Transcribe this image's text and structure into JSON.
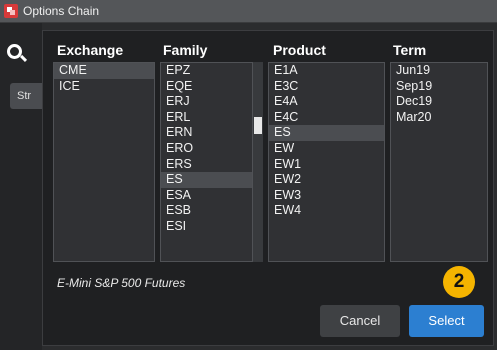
{
  "window": {
    "title": "Options Chain"
  },
  "sidebar": {
    "tab_label": "Str"
  },
  "headers": {
    "exchange": "Exchange",
    "family": "Family",
    "product": "Product",
    "term": "Term"
  },
  "exchange": {
    "items": [
      "CME",
      "ICE"
    ],
    "selected": 0
  },
  "family": {
    "items": [
      "EPZ",
      "EQE",
      "ERJ",
      "ERL",
      "ERN",
      "ERO",
      "ERS",
      "ES",
      "ESA",
      "ESB",
      "ESI"
    ],
    "selected": 7
  },
  "product": {
    "items": [
      "E1A",
      "E3C",
      "E4A",
      "E4C",
      "ES",
      "EW",
      "EW1",
      "EW2",
      "EW3",
      "EW4"
    ],
    "selected": 4
  },
  "term": {
    "items": [
      "Jun19",
      "Sep19",
      "Dec19",
      "Mar20"
    ],
    "selected": -1
  },
  "description": "E-Mini S&P 500 Futures",
  "buttons": {
    "cancel": "Cancel",
    "select": "Select"
  },
  "badge": {
    "number": "2"
  },
  "colors": {
    "accent": "#2c7fd1",
    "badge": "#f5b400"
  }
}
